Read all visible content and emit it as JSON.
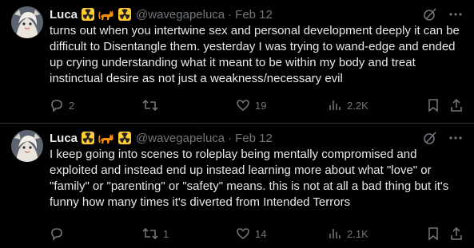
{
  "tweets": [
    {
      "author": {
        "name": "Luca",
        "handle": "@wavegapeluca"
      },
      "date": "Feb 12",
      "separator": "·",
      "text": "turns out when you intertwine sex and personal development deeply it can be difficult to Disentangle them. yesterday I was trying to wand-edge and ended up crying understanding what it meant to be within my body and treat instinctual desire as not just a weakness/necessary evil",
      "stats": {
        "replies": "2",
        "retweets": "",
        "likes": "19",
        "views": "2.2K"
      }
    },
    {
      "author": {
        "name": "Luca",
        "handle": "@wavegapeluca"
      },
      "date": "Feb 12",
      "separator": "·",
      "text": "I keep going into scenes to roleplay being mentally compromised and exploited and instead end up instead learning more about what \"love\" or \"family\" or \"parenting\" or \"safety\" means. this is not at all a bad thing but it's funny how many times it's diverted from Intended Terrors",
      "stats": {
        "replies": "",
        "retweets": "1",
        "likes": "14",
        "views": "2.1K"
      }
    }
  ],
  "icons": {
    "name_badges": [
      "radioactive-icon",
      "cat-icon",
      "radioactive-icon"
    ],
    "header": [
      "grok-icon",
      "more-icon"
    ],
    "actions": [
      "reply-icon",
      "retweet-icon",
      "like-icon",
      "views-icon",
      "bookmark-icon",
      "share-icon"
    ]
  },
  "colors": {
    "background": "#000000",
    "text": "#e7e9ea",
    "muted": "#71767b",
    "divider": "#2f3336",
    "badge_yellow": "#ffcc33",
    "cat_orange": "#f4900c"
  }
}
